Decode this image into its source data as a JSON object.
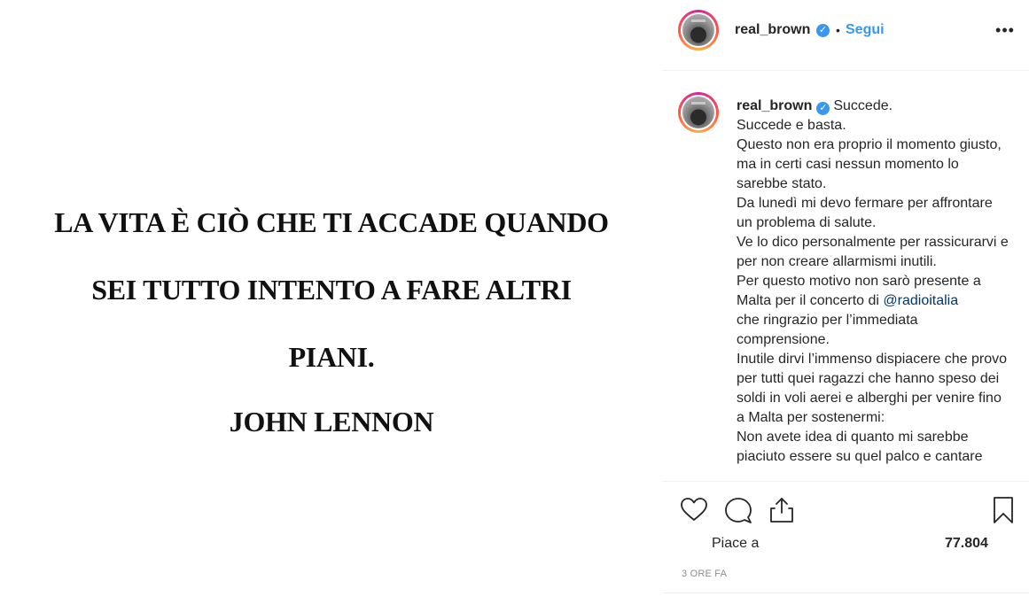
{
  "image": {
    "quote_lines": [
      "LA VITA È CIÒ CHE TI ACCADE QUANDO",
      "SEI TUTTO INTENTO A FARE ALTRI",
      "PIANI.",
      "JOHN LENNON"
    ]
  },
  "header": {
    "username": "real_brown",
    "separator": "•",
    "follow_label": "Segui",
    "more_label": "•••"
  },
  "caption": {
    "username": "real_brown",
    "text_before_mention": "Succede.\nSuccede e basta.\nQuesto non era proprio il momento giusto, ma in certi casi nessun momento lo sarebbe stato.\nDa lunedì mi devo fermare per affrontare un problema di salute.\nVe lo dico personalmente per rassicurarvi e per non creare allarmismi inutili.\nPer questo motivo non sarò presente a Malta per il concerto di ",
    "mention": "@radioitalia",
    "text_after_mention": "\nche ringrazio per l’immediata comprensione.\nInutile dirvi l’immenso dispiacere che provo per tutti quei ragazzi che hanno speso dei soldi in voli aerei e alberghi per venire fino a Malta per sostenermi:\nNon avete idea di quanto mi sarebbe piaciuto essere su quel palco e cantare"
  },
  "actions": {
    "icons": [
      "heart-icon",
      "comment-icon",
      "share-icon",
      "bookmark-icon"
    ]
  },
  "likes": {
    "label": "Piace a",
    "count": "77.804"
  },
  "timestamp": "3 ORE FA",
  "colors": {
    "accent": "#3897f0",
    "mention": "#00376b",
    "muted": "#8e8e8e",
    "divider": "#efefef"
  }
}
